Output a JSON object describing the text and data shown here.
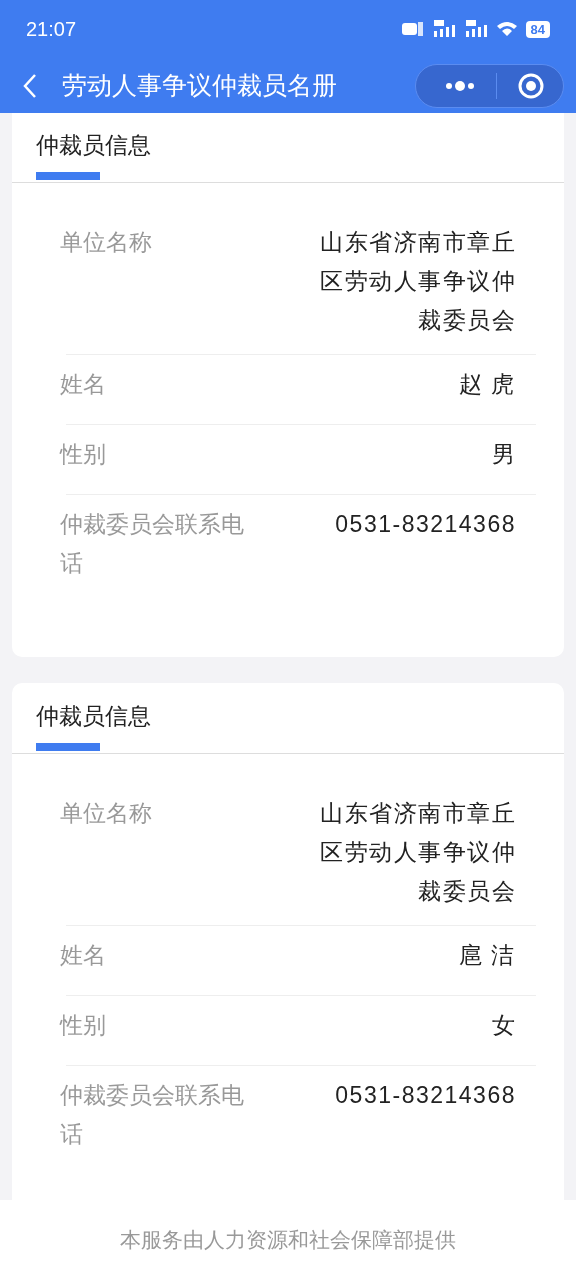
{
  "status_bar": {
    "time": "21:07",
    "battery": "84"
  },
  "nav": {
    "title": "劳动人事争议仲裁员名册"
  },
  "cards": [
    {
      "title": "仲裁员信息",
      "fields": [
        {
          "label": "单位名称",
          "value": "山东省济南市章丘区劳动人事争议仲裁委员会"
        },
        {
          "label": "姓名",
          "value": "赵 虎"
        },
        {
          "label": "性别",
          "value": "男"
        },
        {
          "label": "仲裁委员会联系电话",
          "value": "0531-83214368"
        }
      ]
    },
    {
      "title": "仲裁员信息",
      "fields": [
        {
          "label": "单位名称",
          "value": "山东省济南市章丘区劳动人事争议仲裁委员会"
        },
        {
          "label": "姓名",
          "value": "扈 洁"
        },
        {
          "label": "性别",
          "value": "女"
        },
        {
          "label": "仲裁委员会联系电话",
          "value": "0531-83214368"
        }
      ]
    }
  ],
  "footer": {
    "text": "本服务由人力资源和社会保障部提供"
  }
}
